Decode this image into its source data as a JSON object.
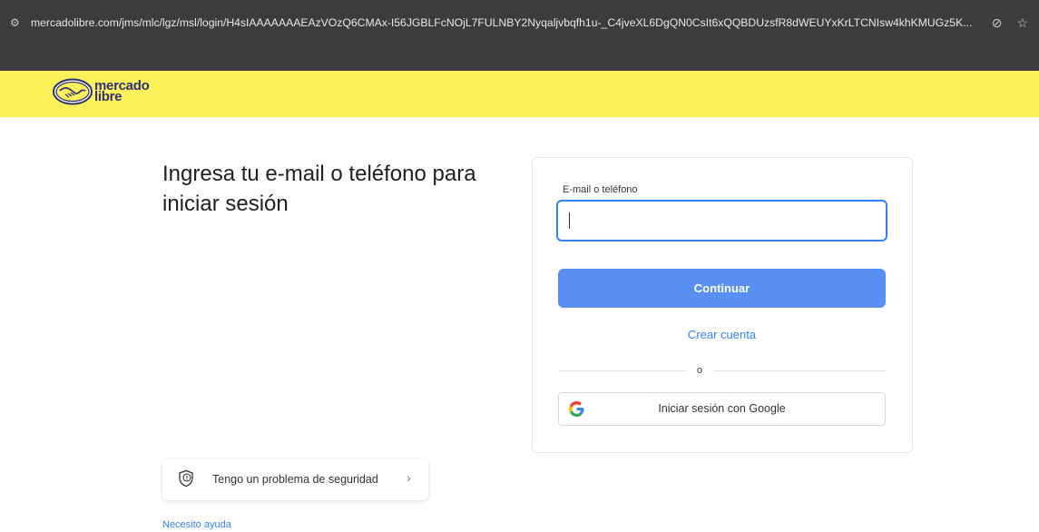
{
  "browser": {
    "url": "mercadolibre.com/jms/mlc/lgz/msl/login/H4sIAAAAAAAEAzVOzQ6CMAx-I56JGBLFcNOjL7FULNBY2Nyqaljvbqfh1u-_C4jveXL6DgQN0CsIt6xQQBDUzsfR8dWEUYxKrLTCNIsw4khKMUGz5K...",
    "tune_icon": "tune-icon",
    "eye_icon": "eye-off-icon",
    "star_icon": "star-icon"
  },
  "header": {
    "logo_line1": "mercado",
    "logo_line2": "libre",
    "bg_color": "#fff159",
    "brand_color": "#2d3277"
  },
  "main": {
    "title": "Ingresa tu e-mail o teléfono para iniciar sesión"
  },
  "login": {
    "field_label": "E-mail o teléfono",
    "field_value": "",
    "continue_label": "Continuar",
    "create_account_label": "Crear cuenta",
    "divider_label": "o",
    "google_label": "Iniciar sesión con Google",
    "accent_color": "#3483fa",
    "button_color": "#5a8ff3"
  },
  "security": {
    "label": "Tengo un problema de seguridad",
    "icon": "shield-alert-icon",
    "chevron_icon": "chevron-right-icon"
  },
  "help": {
    "label": "Necesito ayuda"
  }
}
